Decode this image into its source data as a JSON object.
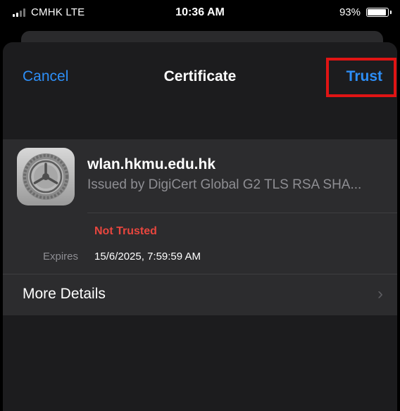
{
  "status_bar": {
    "carrier": "CMHK  LTE",
    "time": "10:36 AM",
    "battery": "93%",
    "battery_level": 0.93,
    "signal_icon": "signal-bars-icon",
    "battery_icon": "battery-icon"
  },
  "nav": {
    "cancel_label": "Cancel",
    "title": "Certificate",
    "trust_label": "Trust",
    "highlight_color": "#e01414",
    "accent_color": "#2d8ef6"
  },
  "certificate": {
    "icon": "gear-certificate-icon",
    "name": "wlan.hkmu.edu.hk",
    "issuer": "Issued by DigiCert Global G2 TLS RSA SHA...",
    "status": "Not Trusted",
    "status_color": "#e8463e",
    "expires_label": "Expires",
    "expires_value": "15/6/2025, 7:59:59 AM"
  },
  "details": {
    "more_details_label": "More Details",
    "chevron_icon": "chevron-right-icon"
  }
}
